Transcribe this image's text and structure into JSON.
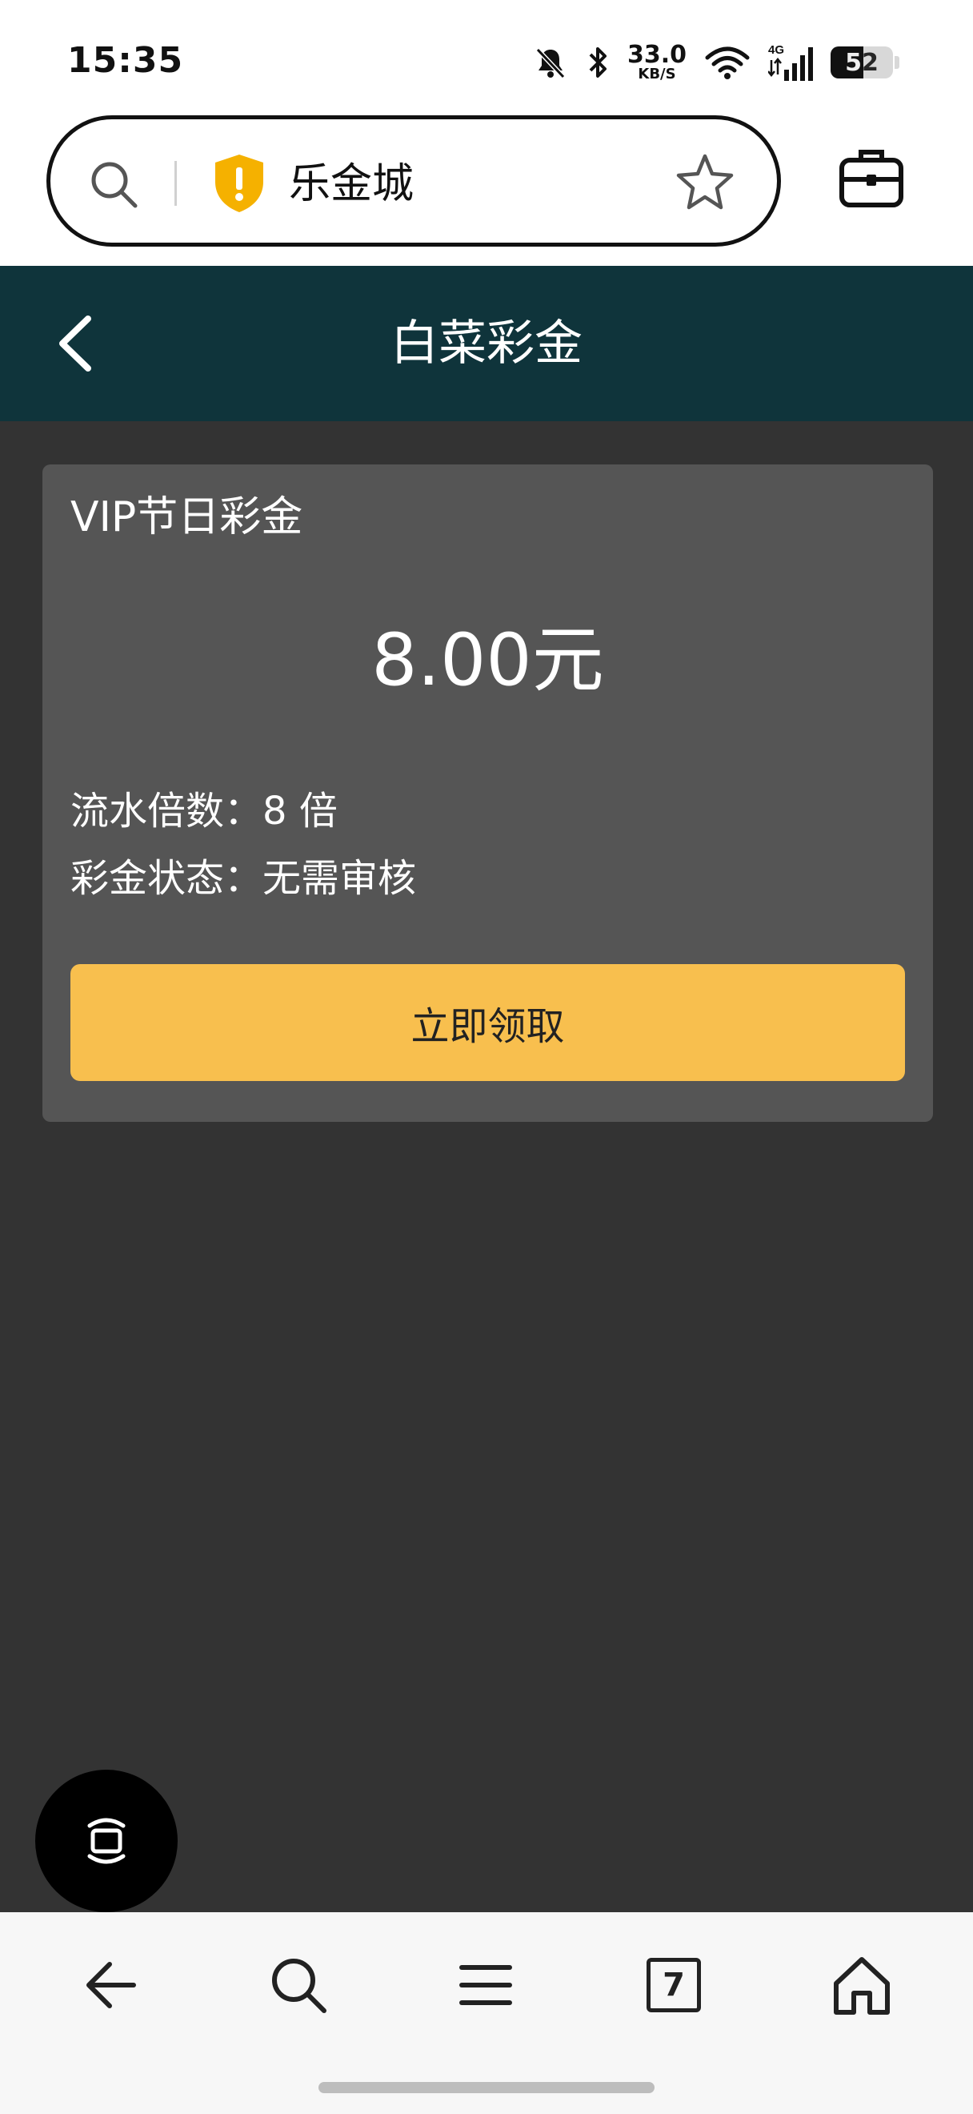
{
  "status_bar": {
    "time": "15:35",
    "net_speed_value": "33.0",
    "net_speed_unit": "KB/S",
    "network_type": "4G",
    "battery_level": "52",
    "battery_fraction": 0.52,
    "icons": [
      "bell-muted-icon",
      "bluetooth-icon",
      "wifi-icon",
      "cell-signal-icon",
      "battery-icon"
    ]
  },
  "browser": {
    "site_title": "乐金城",
    "security_color": "#f5b100",
    "icons": [
      "search-icon",
      "shield-warning-icon",
      "star-icon",
      "toolbox-icon"
    ]
  },
  "page": {
    "title": "白菜彩金",
    "header_color": "#0f343b",
    "background_color": "#333333"
  },
  "bonus_card": {
    "name": "VIP节日彩金",
    "amount": "8.00元",
    "turnover_label": "流水倍数：",
    "turnover_value": "8 倍",
    "status_label": "彩金状态：",
    "status_value": "无需审核",
    "claim_label": "立即领取",
    "button_color": "#f8bf4e"
  },
  "bottom_nav": {
    "tab_count": "7",
    "icons": [
      "back-arrow-icon",
      "search-icon",
      "menu-icon",
      "tabs-icon",
      "home-icon"
    ]
  }
}
